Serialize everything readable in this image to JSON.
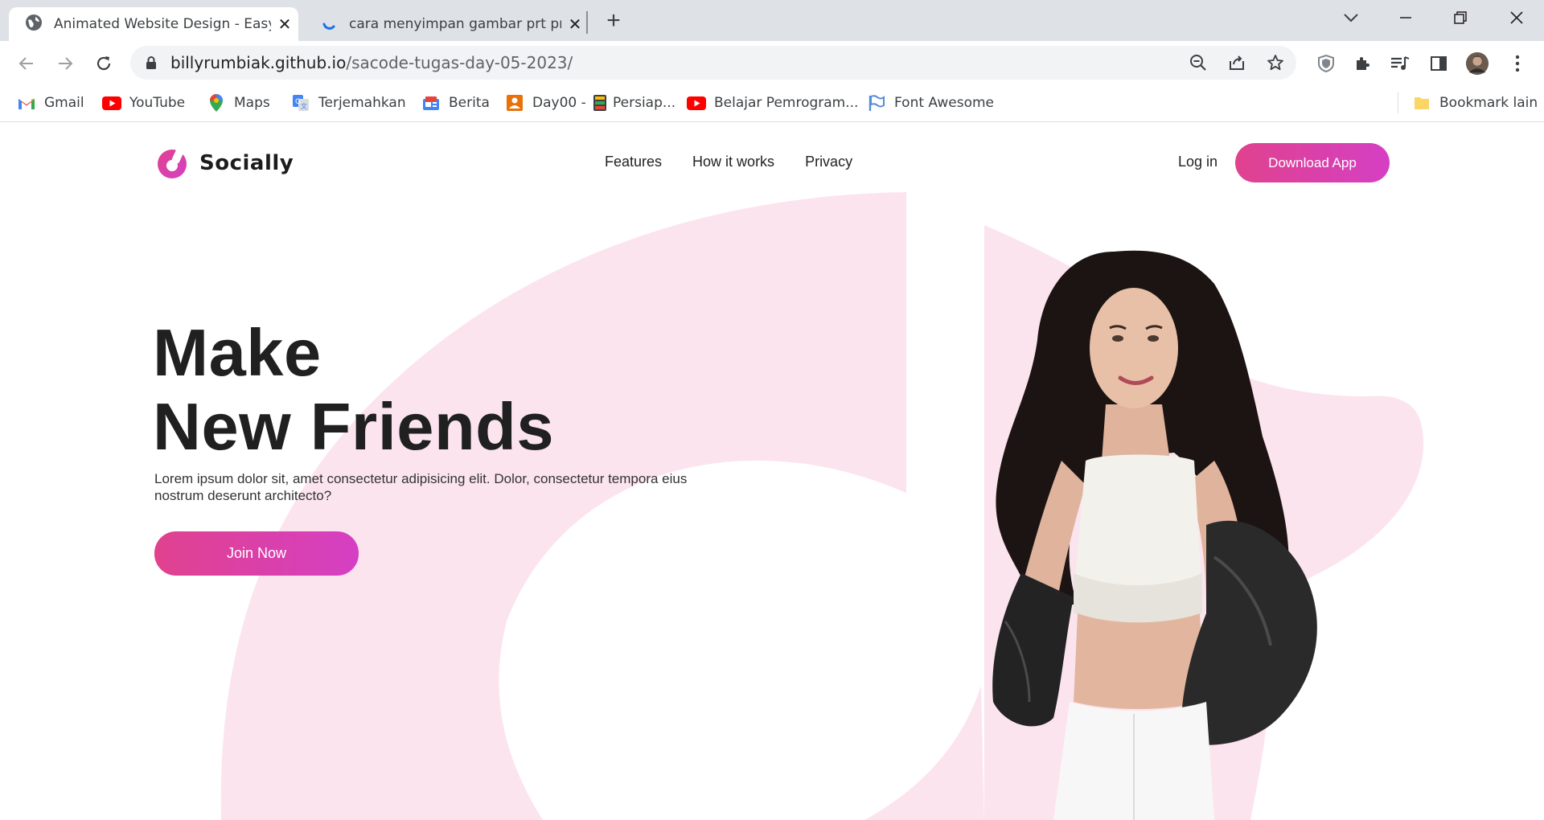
{
  "browser": {
    "tabs": [
      {
        "title": "Animated Website Design - Easy Tutorial",
        "active": true
      },
      {
        "title": "cara menyimpan gambar prt prts",
        "active": false
      }
    ],
    "url_host": "billyrumbiak.github.io",
    "url_path": "/sacode-tugas-day-05-2023/",
    "bookmarks": [
      {
        "label": "Gmail",
        "icon": "gmail-icon"
      },
      {
        "label": "YouTube",
        "icon": "youtube-icon"
      },
      {
        "label": "Maps",
        "icon": "maps-icon"
      },
      {
        "label": "Terjemahkan",
        "icon": "translate-icon"
      },
      {
        "label": "Berita",
        "icon": "news-icon"
      },
      {
        "label": "Day00 -",
        "icon": "classroom-icon"
      },
      {
        "label": "Persiap...",
        "icon": "notebook-icon"
      },
      {
        "label": "Belajar Pemrogram...",
        "icon": "youtube-icon"
      },
      {
        "label": "Font Awesome",
        "icon": "flag-icon"
      }
    ],
    "other_bookmarks": "Bookmark lain"
  },
  "site": {
    "brand": "Socially",
    "nav": [
      "Features",
      "How it works",
      "Privacy"
    ],
    "login": "Log in",
    "download": "Download App",
    "hero_line1": "Make",
    "hero_line2": "New Friends",
    "hero_desc": "Lorem ipsum dolor sit, amet consectetur adipisicing elit. Dolor, consectetur tempora eius nostrum deserunt architecto?",
    "cta": "Join Now"
  },
  "colors": {
    "accent_start": "#e0428e",
    "accent_end": "#d53fc3",
    "blob": "#fce4ef"
  }
}
